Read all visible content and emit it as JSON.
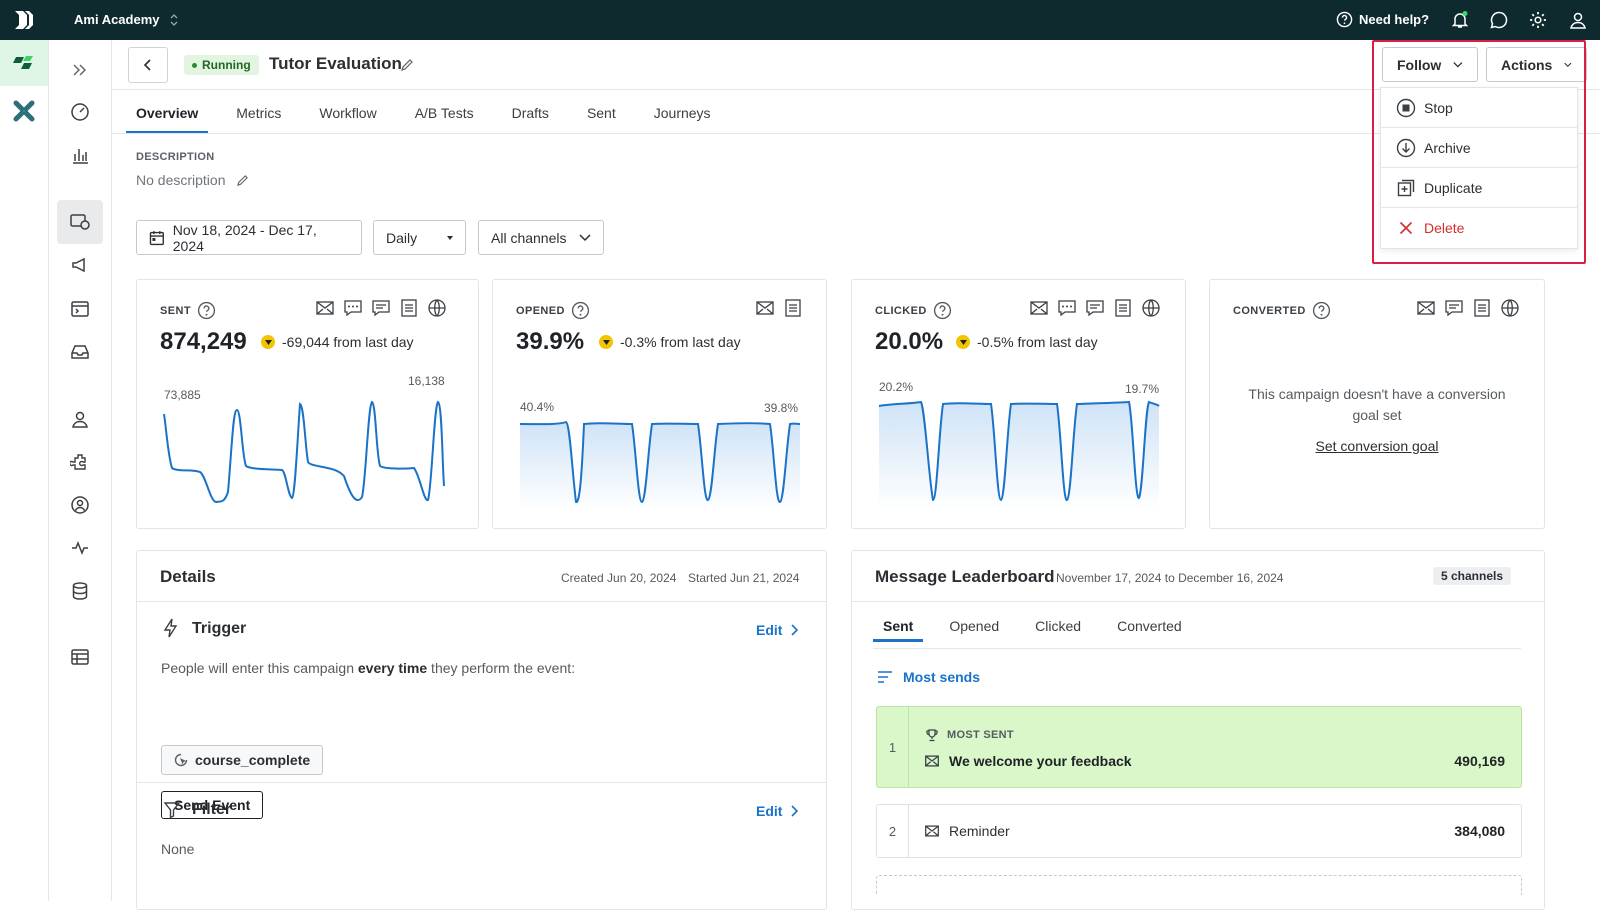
{
  "topbar": {
    "workspace": "Ami Academy",
    "help": "Need help?"
  },
  "header": {
    "status": "Running",
    "title": "Tutor Evaluation"
  },
  "header_buttons": {
    "follow": "Follow",
    "actions": "Actions"
  },
  "actions_menu": [
    "Stop",
    "Archive",
    "Duplicate",
    "Delete"
  ],
  "tabs": [
    "Overview",
    "Metrics",
    "Workflow",
    "A/B Tests",
    "Drafts",
    "Sent",
    "Journeys"
  ],
  "description": {
    "label": "DESCRIPTION",
    "value": "No description"
  },
  "filters": {
    "date_range": "Nov 18, 2024 - Dec 17, 2024",
    "interval": "Daily",
    "channels": "All channels"
  },
  "metrics": [
    {
      "label": "SENT",
      "value": "874,249",
      "delta": "-69,044 from last day",
      "start_label": "73,885",
      "end_label": "16,138"
    },
    {
      "label": "OPENED",
      "value": "39.9%",
      "delta": "-0.3% from last day",
      "start_label": "40.4%",
      "end_label": "39.8%"
    },
    {
      "label": "CLICKED",
      "value": "20.0%",
      "delta": "-0.5% from last day",
      "start_label": "20.2%",
      "end_label": "19.7%"
    },
    {
      "label": "CONVERTED",
      "empty_text": "This campaign doesn't have a conversion goal set",
      "link": "Set conversion goal"
    }
  ],
  "details": {
    "title": "Details",
    "created": "Created Jun 20, 2024",
    "started": "Started Jun 21, 2024",
    "trigger_title": "Trigger",
    "edit": "Edit",
    "trigger_text_before": "People will enter this campaign ",
    "trigger_text_bold": "every time",
    "trigger_text_after": " they perform the event:",
    "event": "course_complete",
    "send_event": "Send Event",
    "filter_title": "Filter",
    "filter_value": "None"
  },
  "leaderboard": {
    "title": "Message Leaderboard",
    "range": "November 17, 2024 to December 16, 2024",
    "channels": "5 channels",
    "tabs": [
      "Sent",
      "Opened",
      "Clicked",
      "Converted"
    ],
    "sort": "Most sends",
    "most_sent_label": "MOST SENT",
    "rows": [
      {
        "rank": "1",
        "name": "We welcome your feedback",
        "value": "490,169"
      },
      {
        "rank": "2",
        "name": "Reminder",
        "value": "384,080"
      }
    ]
  },
  "colors": {
    "accent": "#1a73c8",
    "topbar": "#0e2a2e",
    "running_bg": "#e3f4e0",
    "delete": "#d32f2f",
    "highlight": "#d91f43",
    "winner_bg": "#d9f7c8"
  }
}
